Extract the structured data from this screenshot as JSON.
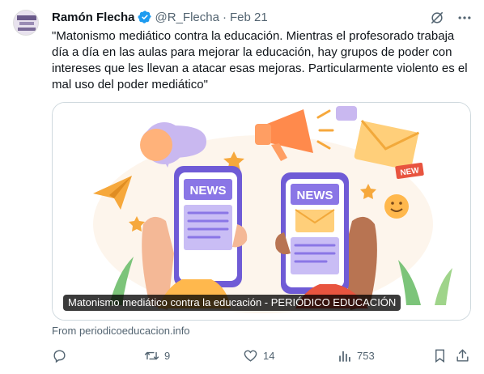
{
  "tweet": {
    "author_name": "Ramón Flecha",
    "handle": "@R_Flecha",
    "separator": "·",
    "date": "Feb 21",
    "text": "\"Matonismo mediático contra la educación. Mientras el profesorado trabaja día a día en las aulas para mejorar la educación, hay grupos de poder con intereses que les llevan a atacar esas mejoras. Particularmente violento es el mal uso del poder mediático\""
  },
  "card": {
    "title": "Matonismo mediático contra la educación - PERIÓDICO EDUCACIÓN",
    "image_labels": {
      "phone_left": "NEWS",
      "phone_right": "NEWS",
      "envelope_badge": "NEW"
    },
    "source": "From periodicoeducacion.info"
  },
  "actions": {
    "reply_count": "",
    "retweet_count": "9",
    "like_count": "14",
    "views_count": "753"
  },
  "colors": {
    "accent_verified": "#1d9bf0",
    "secondary_text": "#536471",
    "primary_text": "#0f1419"
  },
  "icons": [
    "verified-badge-icon",
    "grok-icon",
    "more-icon",
    "reply-icon",
    "retweet-icon",
    "like-icon",
    "views-icon",
    "bookmark-icon",
    "share-icon"
  ]
}
